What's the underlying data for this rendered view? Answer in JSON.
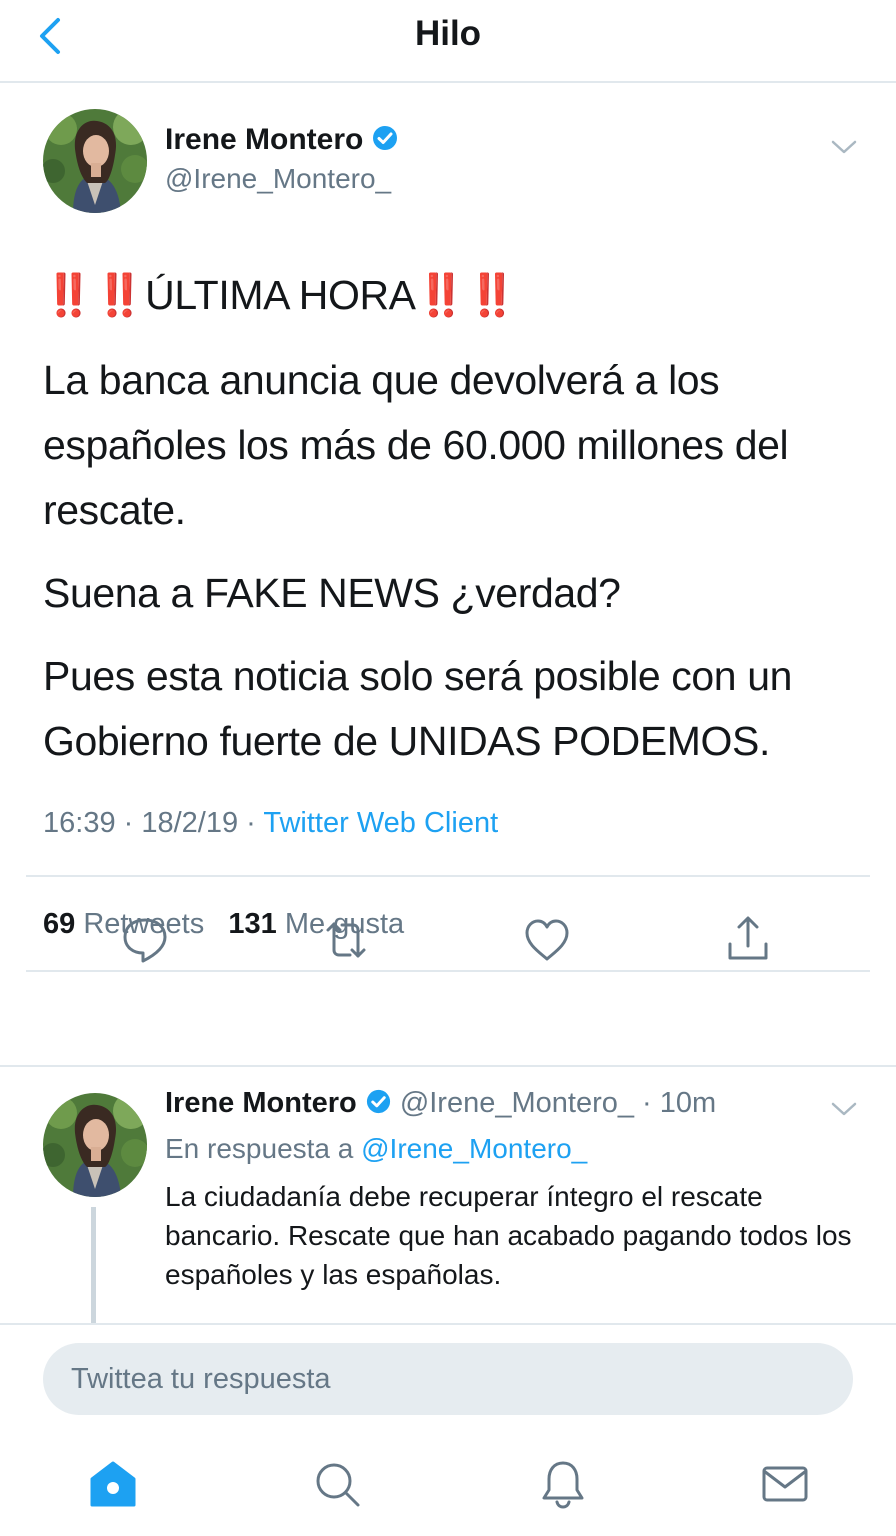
{
  "header": {
    "title": "Hilo",
    "back_icon": "chevron-left-icon"
  },
  "colors": {
    "accent": "#1da1f2",
    "secondary_text": "#657786",
    "primary_text": "#14171a",
    "divider": "#e1e8ed",
    "alert_red": "#dd2e44"
  },
  "main_tweet": {
    "author_name": "Irene Montero",
    "handle": "@Irene_Montero_",
    "headline_marks_left": "‼️‼️",
    "headline_text": "ÚLTIMA HORA",
    "headline_marks_right": "‼️‼️",
    "paragraphs": [
      "La banca anuncia que devolverá a los españoles los más de 60.000 millones del rescate.",
      "Suena a FAKE NEWS ¿verdad?",
      "Pues esta noticia solo será posible con un Gobierno fuerte de UNIDAS PODEMOS."
    ],
    "time": "16:39",
    "date": "18/2/19",
    "source": "Twitter Web Client",
    "retweets_count": "69",
    "retweets_label": "Retweets",
    "likes_count": "131",
    "likes_label": "Me gusta"
  },
  "reply_tweet": {
    "author_name": "Irene Montero",
    "handle": "@Irene_Montero_",
    "time_ago": "10m",
    "reply_to_label": "En respuesta a",
    "reply_to_handle": "@Irene_Montero_",
    "text": "La ciudadanía debe recuperar íntegro el rescate bancario. Rescate que han acabado pagando todos los españoles y las españolas."
  },
  "composer": {
    "placeholder": "Twittea tu respuesta"
  },
  "tabbar": {
    "items": [
      "home-icon",
      "search-icon",
      "notifications-icon",
      "messages-icon"
    ]
  }
}
